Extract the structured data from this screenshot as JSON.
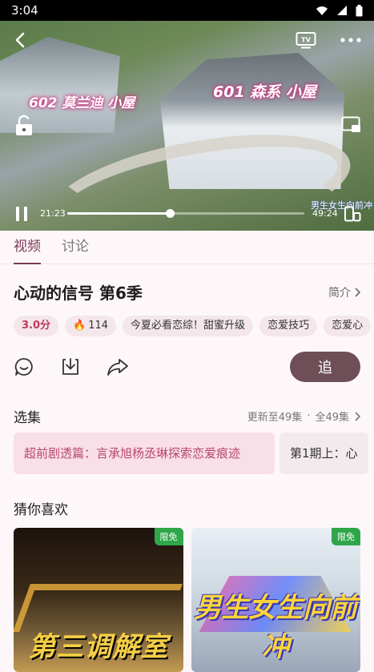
{
  "status_bar": {
    "time": "3:04",
    "wifi_icon": "wifi-icon",
    "signal_icon": "signal-icon",
    "battery_icon": "battery-icon"
  },
  "player": {
    "captions": [
      "602 莫兰迪 小屋",
      "601 森系 小屋"
    ],
    "watermark": "男生女生向前冲",
    "current_time": "21:23",
    "total_time": "49:24",
    "progress": 0.433
  },
  "tabs": [
    {
      "label": "视频",
      "active": true
    },
    {
      "label": "讨论",
      "active": false
    }
  ],
  "show": {
    "title": "心动的信号 第6季",
    "intro_label": "简介",
    "score": "3.0分",
    "heat": "114",
    "tags": [
      "今夏必看恋综！甜蜜升级",
      "恋爱技巧",
      "恋爱心"
    ]
  },
  "actions": {
    "follow_label": "追"
  },
  "episodes_section": {
    "title": "选集",
    "meta": "更新至49集",
    "all_label": "全49集",
    "items": [
      {
        "label": "超前剧透篇：言承旭杨丞琳探索恋爱痕迹",
        "active": true
      },
      {
        "label": "第1期上：心",
        "active": false
      }
    ]
  },
  "recommend_section": {
    "title": "猜你喜欢",
    "cards": [
      {
        "badge": "限免",
        "art_text": "第三调解室"
      },
      {
        "badge": "限免",
        "art_text": "男生女生向前冲"
      }
    ]
  },
  "colors": {
    "accent": "#7b3a55",
    "follow_button": "#6e4f58",
    "score": "#c0395a",
    "badge": "#2fa64a"
  }
}
